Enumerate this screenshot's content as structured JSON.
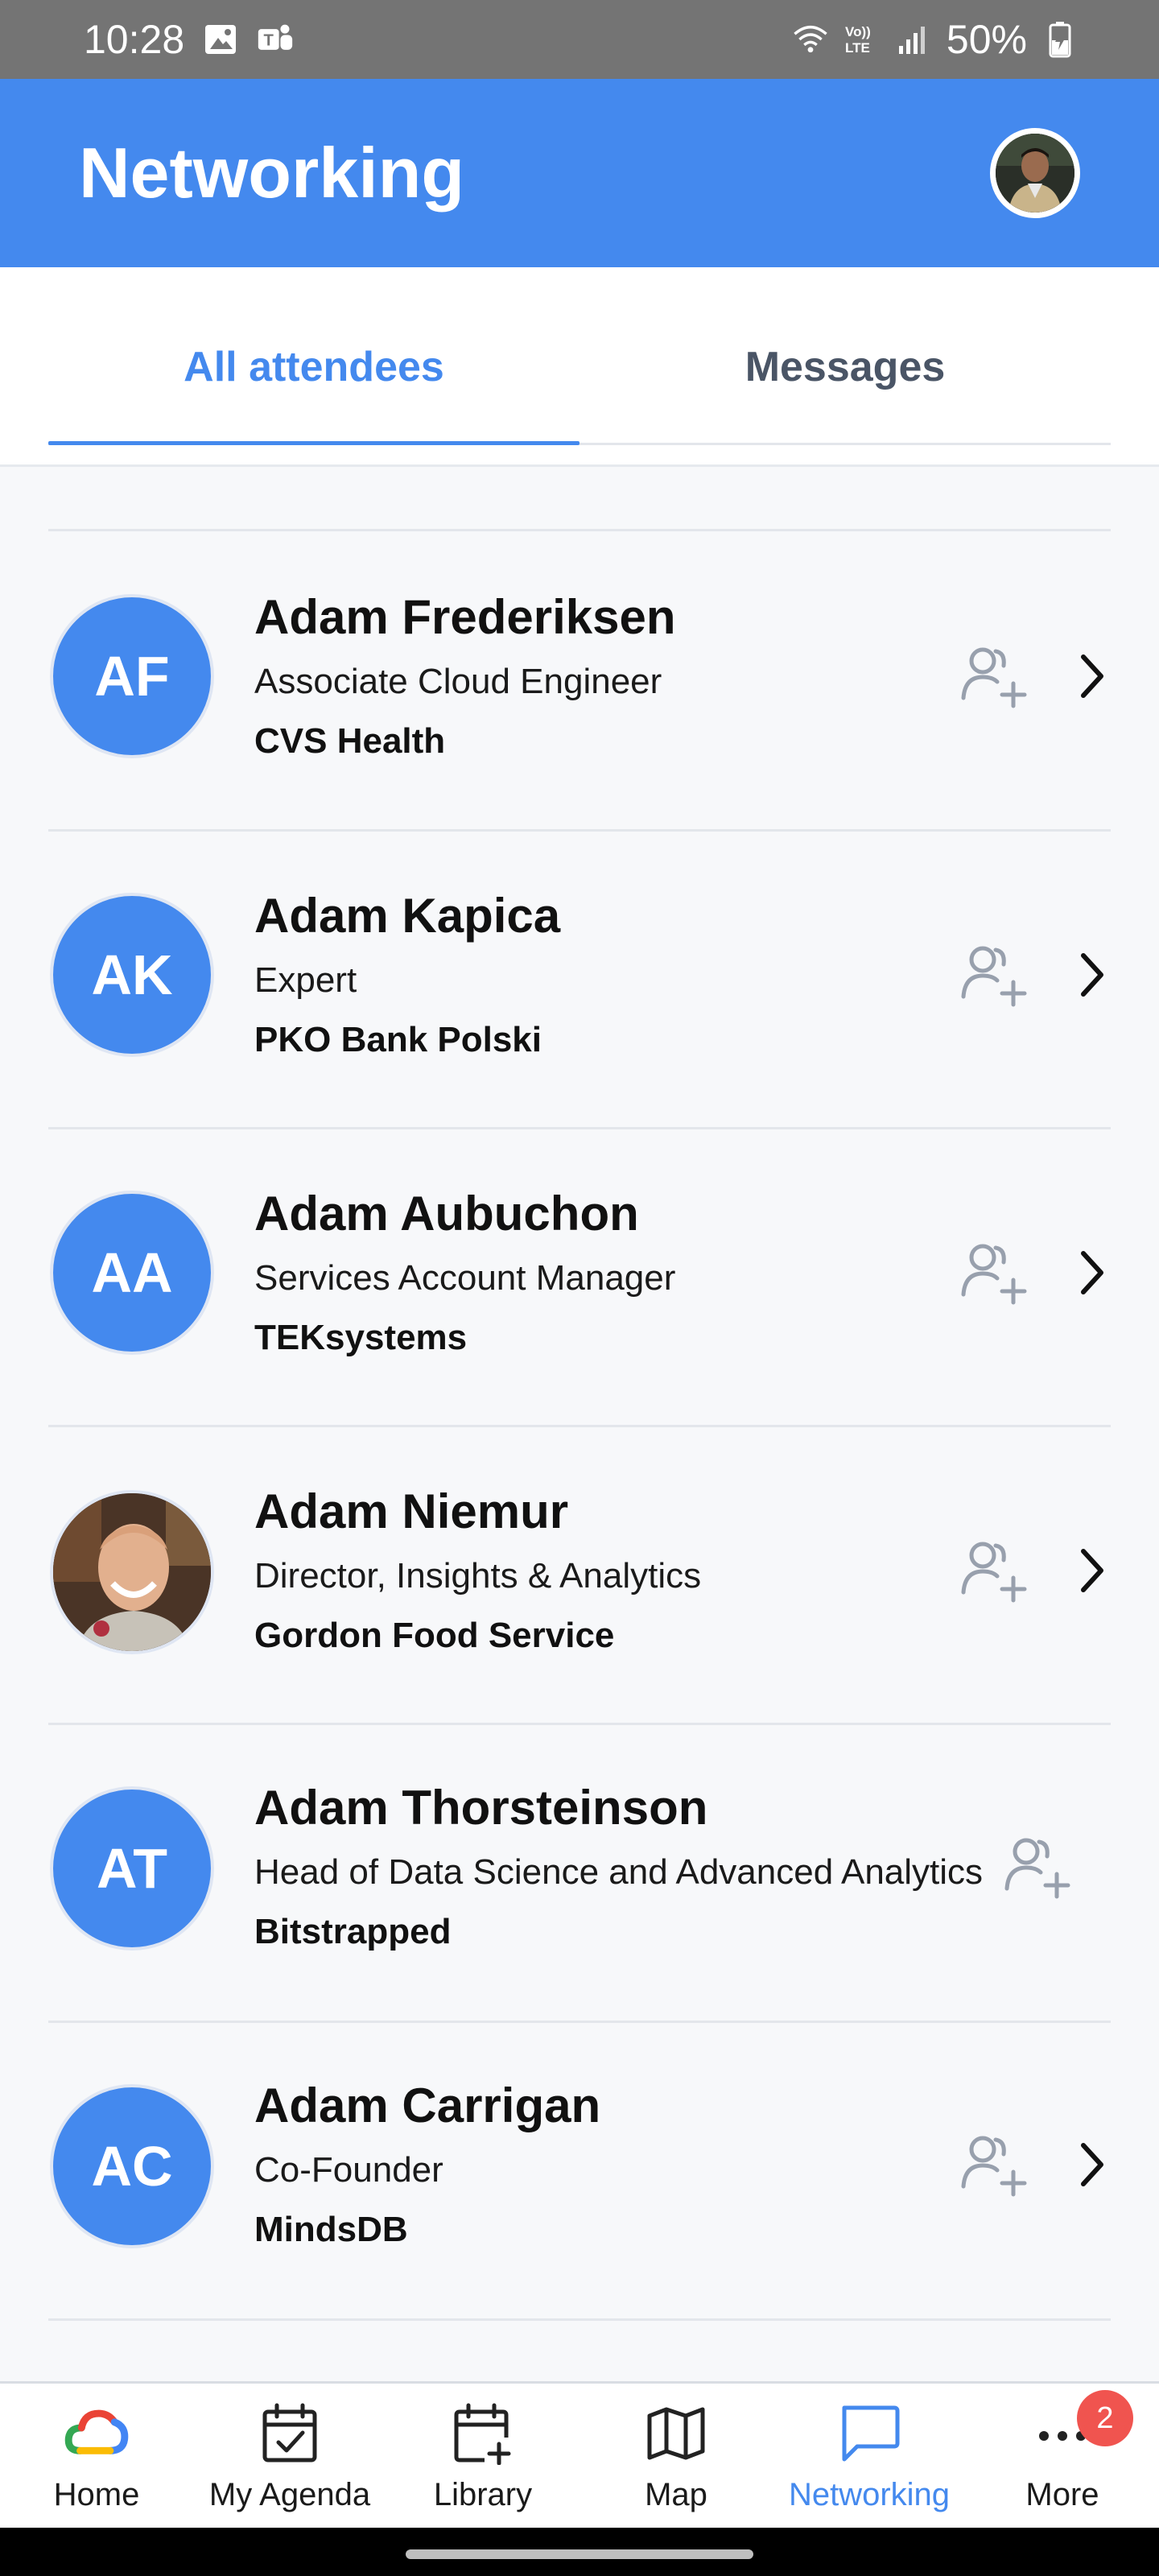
{
  "status_bar": {
    "time": "10:28",
    "battery": "50%"
  },
  "header": {
    "title": "Networking"
  },
  "tabs": [
    {
      "label": "All attendees",
      "active": true
    },
    {
      "label": "Messages",
      "active": false
    }
  ],
  "attendees": [
    {
      "initials": "AF",
      "name": "Adam Frederiksen",
      "title": "Associate Cloud Engineer",
      "company": "CVS Health",
      "has_photo": false,
      "has_chevron": true
    },
    {
      "initials": "AK",
      "name": "Adam Kapica",
      "title": "Expert",
      "company": "PKO Bank Polski",
      "has_photo": false,
      "has_chevron": true
    },
    {
      "initials": "AA",
      "name": "Adam Aubuchon",
      "title": "Services Account Manager",
      "company": "TEKsystems",
      "has_photo": false,
      "has_chevron": true
    },
    {
      "initials": "",
      "name": "Adam Niemur",
      "title": "Director, Insights & Analytics",
      "company": "Gordon Food Service",
      "has_photo": true,
      "has_chevron": true
    },
    {
      "initials": "AT",
      "name": "Adam Thorsteinson",
      "title": "Head of Data Science and Advanced Analytics",
      "company": "Bitstrapped",
      "has_photo": false,
      "has_chevron": false
    },
    {
      "initials": "AC",
      "name": "Adam Carrigan",
      "title": "Co-Founder",
      "company": "MindsDB",
      "has_photo": false,
      "has_chevron": true
    }
  ],
  "bottom_nav": [
    {
      "label": "Home",
      "icon": "google-cloud-icon",
      "active": false
    },
    {
      "label": "My Agenda",
      "icon": "calendar-check-icon",
      "active": false
    },
    {
      "label": "Library",
      "icon": "calendar-plus-icon",
      "active": false
    },
    {
      "label": "Map",
      "icon": "map-icon",
      "active": false
    },
    {
      "label": "Networking",
      "icon": "chat-bubble-icon",
      "active": true
    },
    {
      "label": "More",
      "icon": "more-dots-icon",
      "active": false,
      "badge": "2"
    }
  ],
  "colors": {
    "accent": "#4489ee",
    "header": "#4489ee",
    "status_bar": "#747474",
    "badge": "#f0544f"
  }
}
